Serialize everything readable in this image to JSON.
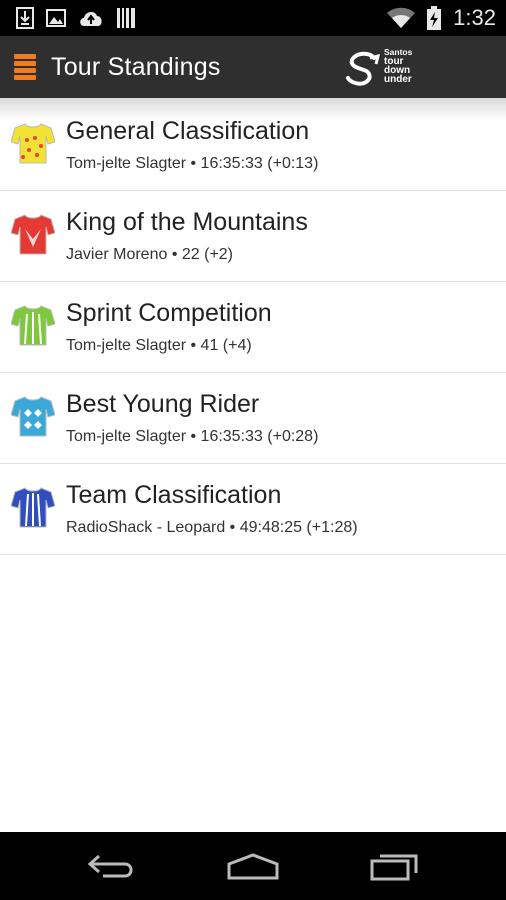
{
  "status_bar": {
    "time": "1:32",
    "left_icons": [
      "download-icon",
      "image-icon",
      "cloud-upload-icon",
      "barcode-icon"
    ],
    "right_icons": [
      "wifi-icon",
      "battery-charging-icon"
    ]
  },
  "action_bar": {
    "title": "Tour Standings",
    "logo_text": [
      "Santos",
      "tour",
      "down",
      "under"
    ]
  },
  "standings": [
    {
      "title": "General Classification",
      "detail": "Tom-jelte Slagter • 16:35:33 (+0:13)",
      "jersey": "yellow-jersey-icon",
      "color": "#f2e233",
      "accent": "#e8403a"
    },
    {
      "title": "King of the Mountains",
      "detail": "Javier Moreno • 22 (+2)",
      "jersey": "red-jersey-icon",
      "color": "#e53a34",
      "accent": "#ffffff"
    },
    {
      "title": "Sprint Competition",
      "detail": "Tom-jelte Slagter • 41 (+4)",
      "jersey": "green-jersey-icon",
      "color": "#7ec83c",
      "accent": "#ffffff"
    },
    {
      "title": "Best Young Rider",
      "detail": "Tom-jelte Slagter • 16:35:33 (+0:28)",
      "jersey": "blue-jersey-icon",
      "color": "#3aa8d8",
      "accent": "#ffffff"
    },
    {
      "title": "Team Classification",
      "detail": "RadioShack - Leopard • 49:48:25 (+1:28)",
      "jersey": "navy-jersey-icon",
      "color": "#2f4fbf",
      "accent": "#ffffff"
    }
  ],
  "nav_bar": {
    "icons": [
      "back-icon",
      "home-icon",
      "recent-apps-icon"
    ]
  },
  "colors": {
    "accent": "#f47a1f",
    "action_bar": "#2f2f2f"
  }
}
